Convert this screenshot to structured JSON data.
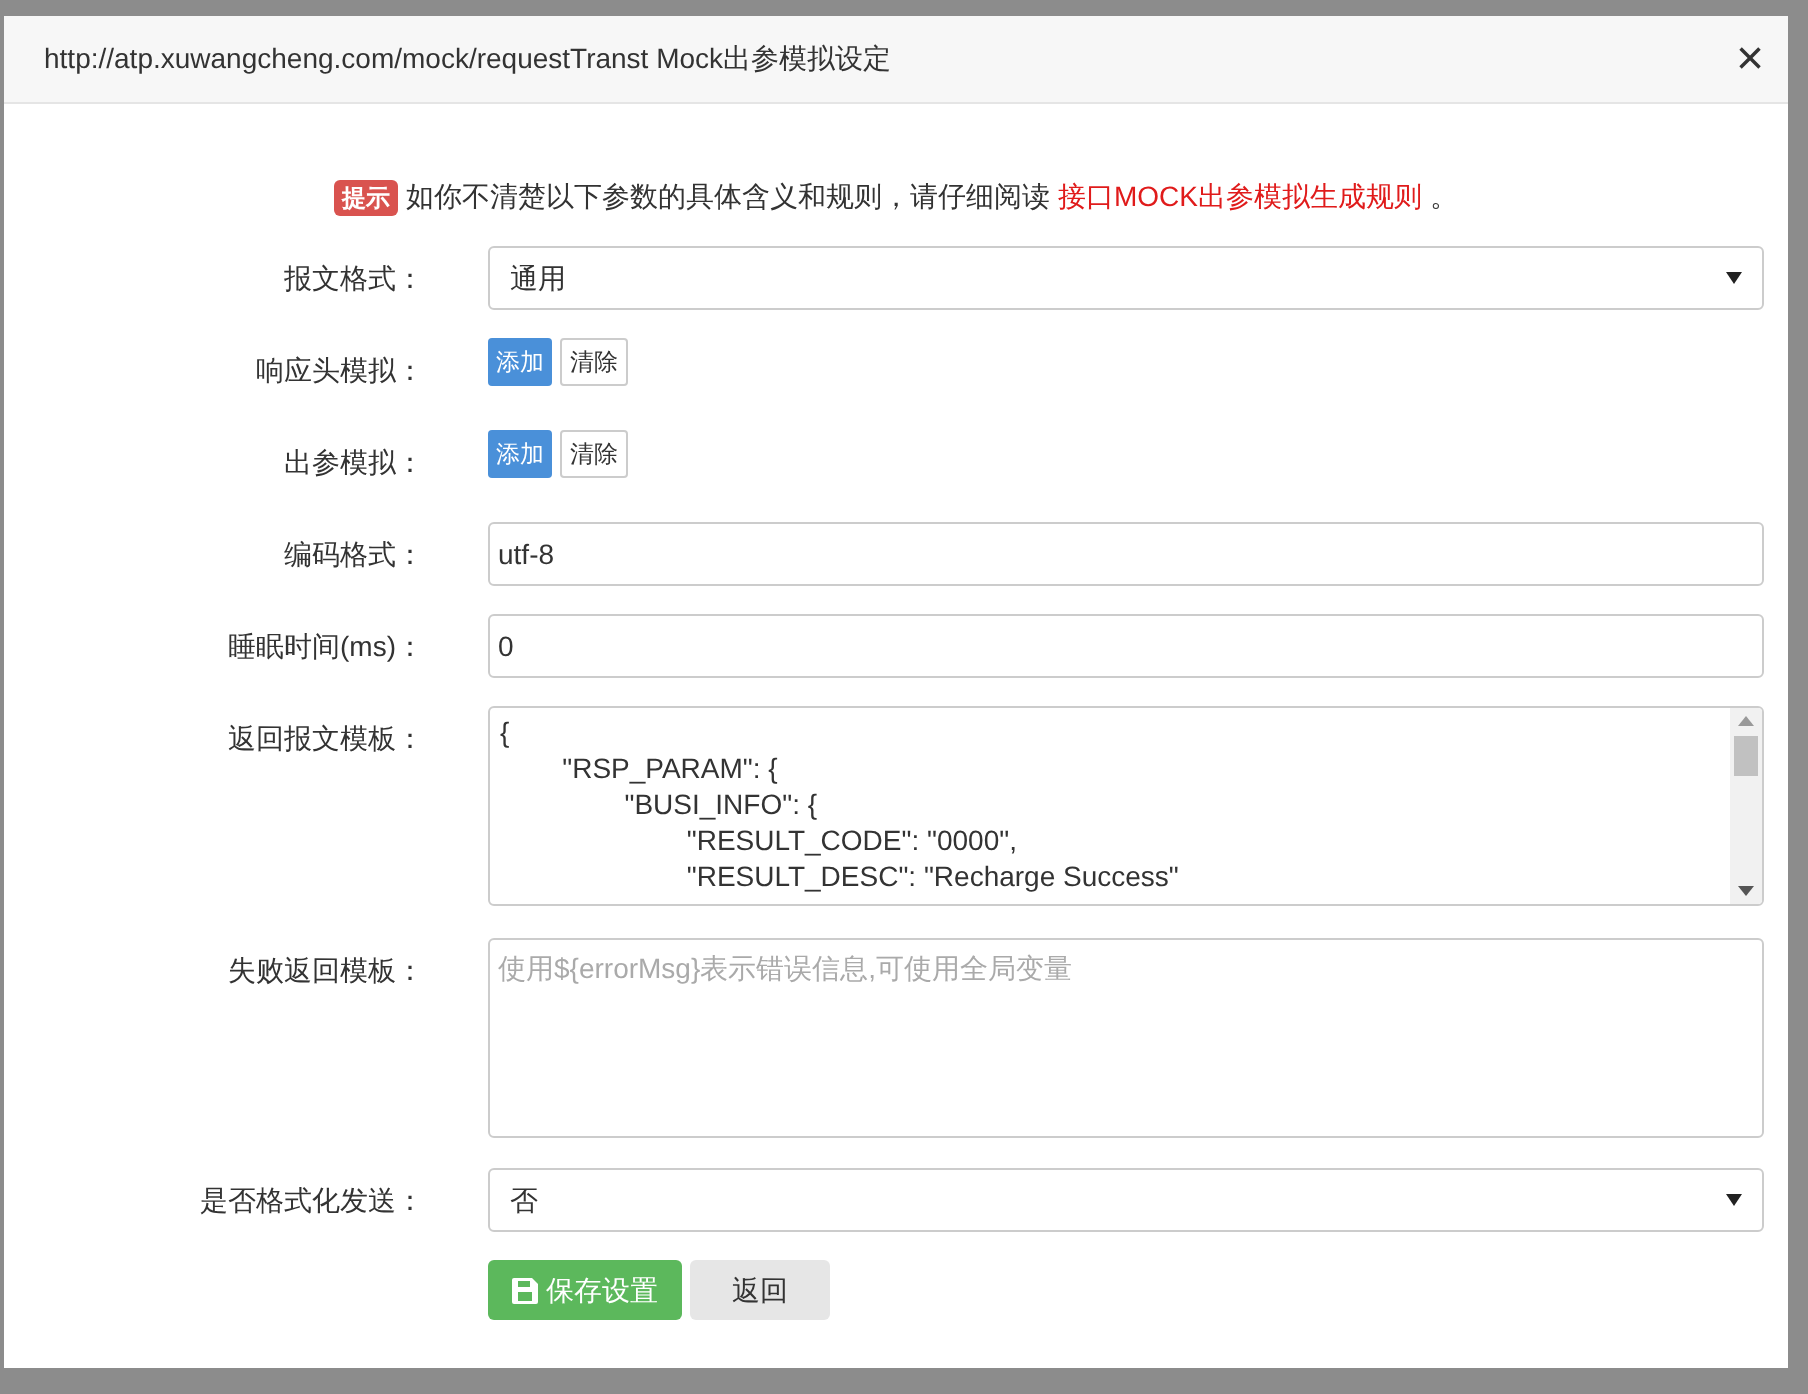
{
  "dialog": {
    "title": "http://atp.xuwangcheng.com/mock/requestTranst Mock出参模拟设定",
    "close": "×"
  },
  "notice": {
    "badge": "提示",
    "text": "如你不清楚以下参数的具体含义和规则，请仔细阅读",
    "link": "接口MOCK出参模拟生成规则",
    "tail": "。"
  },
  "fields": [
    {
      "kind": "select",
      "label": "报文格式：",
      "value": "通用"
    },
    {
      "kind": "buttons",
      "label": "响应头模拟：",
      "buttons": [
        "添加",
        "清除"
      ]
    },
    {
      "kind": "buttons",
      "label": "出参模拟：",
      "buttons": [
        "添加",
        "清除"
      ]
    },
    {
      "kind": "input",
      "label": "编码格式：",
      "value": "utf-8"
    },
    {
      "kind": "input",
      "label": "睡眠时间(ms)：",
      "value": "0"
    },
    {
      "kind": "code",
      "label": "返回报文模板：",
      "value": "{\n\t\"RSP_PARAM\": {\n\t\t\"BUSI_INFO\": {\n\t\t\t\"RESULT_CODE\": \"0000\",\n\t\t\t\"RESULT_DESC\": \"Recharge Success\""
    },
    {
      "kind": "textarea",
      "label": "失败返回模板：",
      "placeholder": "使用${errorMsg}表示错误信息,可使用全局变量"
    },
    {
      "kind": "select",
      "label": "是否格式化发送：",
      "value": "否"
    }
  ],
  "actions": [
    {
      "kind": "primary",
      "label": "保存设置"
    },
    {
      "kind": "default",
      "label": "返回"
    }
  ]
}
